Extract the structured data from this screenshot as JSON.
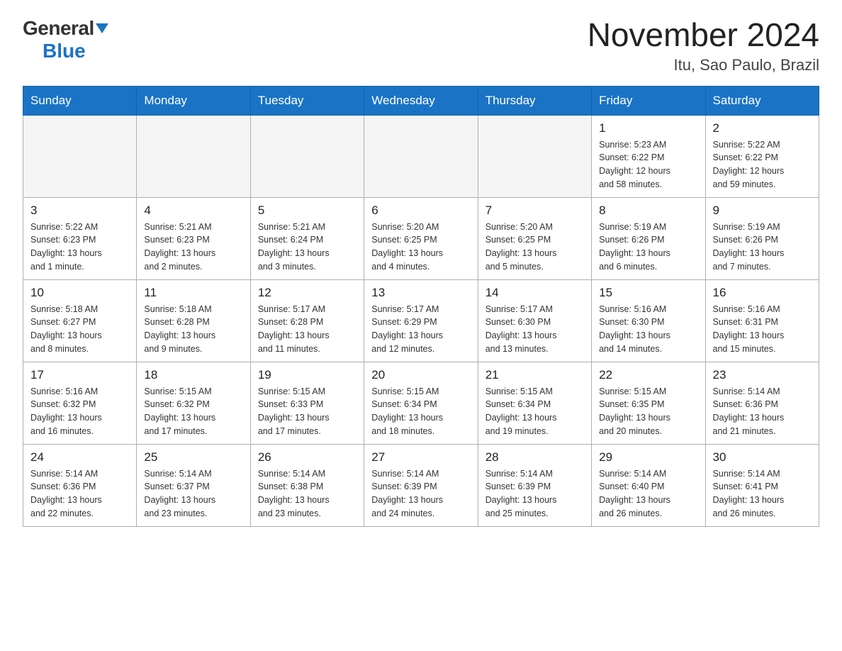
{
  "logo": {
    "general": "General",
    "blue": "Blue",
    "triangle": "▼"
  },
  "title": "November 2024",
  "subtitle": "Itu, Sao Paulo, Brazil",
  "weekdays": [
    "Sunday",
    "Monday",
    "Tuesday",
    "Wednesday",
    "Thursday",
    "Friday",
    "Saturday"
  ],
  "weeks": [
    [
      {
        "day": "",
        "info": ""
      },
      {
        "day": "",
        "info": ""
      },
      {
        "day": "",
        "info": ""
      },
      {
        "day": "",
        "info": ""
      },
      {
        "day": "",
        "info": ""
      },
      {
        "day": "1",
        "info": "Sunrise: 5:23 AM\nSunset: 6:22 PM\nDaylight: 12 hours\nand 58 minutes."
      },
      {
        "day": "2",
        "info": "Sunrise: 5:22 AM\nSunset: 6:22 PM\nDaylight: 12 hours\nand 59 minutes."
      }
    ],
    [
      {
        "day": "3",
        "info": "Sunrise: 5:22 AM\nSunset: 6:23 PM\nDaylight: 13 hours\nand 1 minute."
      },
      {
        "day": "4",
        "info": "Sunrise: 5:21 AM\nSunset: 6:23 PM\nDaylight: 13 hours\nand 2 minutes."
      },
      {
        "day": "5",
        "info": "Sunrise: 5:21 AM\nSunset: 6:24 PM\nDaylight: 13 hours\nand 3 minutes."
      },
      {
        "day": "6",
        "info": "Sunrise: 5:20 AM\nSunset: 6:25 PM\nDaylight: 13 hours\nand 4 minutes."
      },
      {
        "day": "7",
        "info": "Sunrise: 5:20 AM\nSunset: 6:25 PM\nDaylight: 13 hours\nand 5 minutes."
      },
      {
        "day": "8",
        "info": "Sunrise: 5:19 AM\nSunset: 6:26 PM\nDaylight: 13 hours\nand 6 minutes."
      },
      {
        "day": "9",
        "info": "Sunrise: 5:19 AM\nSunset: 6:26 PM\nDaylight: 13 hours\nand 7 minutes."
      }
    ],
    [
      {
        "day": "10",
        "info": "Sunrise: 5:18 AM\nSunset: 6:27 PM\nDaylight: 13 hours\nand 8 minutes."
      },
      {
        "day": "11",
        "info": "Sunrise: 5:18 AM\nSunset: 6:28 PM\nDaylight: 13 hours\nand 9 minutes."
      },
      {
        "day": "12",
        "info": "Sunrise: 5:17 AM\nSunset: 6:28 PM\nDaylight: 13 hours\nand 11 minutes."
      },
      {
        "day": "13",
        "info": "Sunrise: 5:17 AM\nSunset: 6:29 PM\nDaylight: 13 hours\nand 12 minutes."
      },
      {
        "day": "14",
        "info": "Sunrise: 5:17 AM\nSunset: 6:30 PM\nDaylight: 13 hours\nand 13 minutes."
      },
      {
        "day": "15",
        "info": "Sunrise: 5:16 AM\nSunset: 6:30 PM\nDaylight: 13 hours\nand 14 minutes."
      },
      {
        "day": "16",
        "info": "Sunrise: 5:16 AM\nSunset: 6:31 PM\nDaylight: 13 hours\nand 15 minutes."
      }
    ],
    [
      {
        "day": "17",
        "info": "Sunrise: 5:16 AM\nSunset: 6:32 PM\nDaylight: 13 hours\nand 16 minutes."
      },
      {
        "day": "18",
        "info": "Sunrise: 5:15 AM\nSunset: 6:32 PM\nDaylight: 13 hours\nand 17 minutes."
      },
      {
        "day": "19",
        "info": "Sunrise: 5:15 AM\nSunset: 6:33 PM\nDaylight: 13 hours\nand 17 minutes."
      },
      {
        "day": "20",
        "info": "Sunrise: 5:15 AM\nSunset: 6:34 PM\nDaylight: 13 hours\nand 18 minutes."
      },
      {
        "day": "21",
        "info": "Sunrise: 5:15 AM\nSunset: 6:34 PM\nDaylight: 13 hours\nand 19 minutes."
      },
      {
        "day": "22",
        "info": "Sunrise: 5:15 AM\nSunset: 6:35 PM\nDaylight: 13 hours\nand 20 minutes."
      },
      {
        "day": "23",
        "info": "Sunrise: 5:14 AM\nSunset: 6:36 PM\nDaylight: 13 hours\nand 21 minutes."
      }
    ],
    [
      {
        "day": "24",
        "info": "Sunrise: 5:14 AM\nSunset: 6:36 PM\nDaylight: 13 hours\nand 22 minutes."
      },
      {
        "day": "25",
        "info": "Sunrise: 5:14 AM\nSunset: 6:37 PM\nDaylight: 13 hours\nand 23 minutes."
      },
      {
        "day": "26",
        "info": "Sunrise: 5:14 AM\nSunset: 6:38 PM\nDaylight: 13 hours\nand 23 minutes."
      },
      {
        "day": "27",
        "info": "Sunrise: 5:14 AM\nSunset: 6:39 PM\nDaylight: 13 hours\nand 24 minutes."
      },
      {
        "day": "28",
        "info": "Sunrise: 5:14 AM\nSunset: 6:39 PM\nDaylight: 13 hours\nand 25 minutes."
      },
      {
        "day": "29",
        "info": "Sunrise: 5:14 AM\nSunset: 6:40 PM\nDaylight: 13 hours\nand 26 minutes."
      },
      {
        "day": "30",
        "info": "Sunrise: 5:14 AM\nSunset: 6:41 PM\nDaylight: 13 hours\nand 26 minutes."
      }
    ]
  ]
}
